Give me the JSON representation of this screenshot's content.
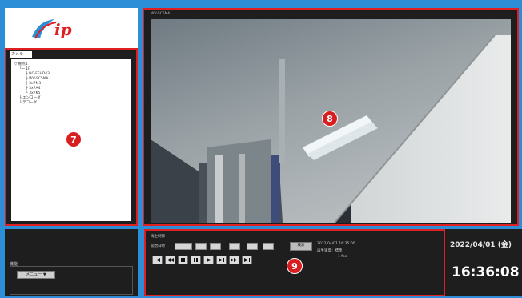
{
  "app": {
    "logo_text": "ip"
  },
  "tree": {
    "tab_label": "カメラ",
    "lines": [
      "▽ 拠点1",
      "└ ─ 1F",
      "├ NC-FFHD43",
      "├ WV-SC5NA",
      "├ 3x7M3",
      "├ 3x7A4",
      "└ 3x7K5",
      "├ エンコーダ",
      "└ デコーダ"
    ]
  },
  "video": {
    "label": "WV-SC5NA"
  },
  "controls": {
    "section_label": "再生制御",
    "start_label": "開始日時",
    "date_fields": [
      "2022",
      "04",
      "01",
      "16",
      "35",
      "00"
    ],
    "search_label": "検索",
    "info_lines": [
      "2022/04/01 16:35:00",
      "再生速度：標準",
      "1 fps"
    ],
    "buttons": [
      "skip-start",
      "rewind",
      "stop",
      "pause",
      "play",
      "step",
      "fast-forward",
      "skip-end"
    ]
  },
  "left_bottom": {
    "label": "機能",
    "button_label": "メニュー ▼"
  },
  "clock": {
    "date": "2022/04/01 (金)",
    "time": "16:36:08"
  },
  "callouts": {
    "tree": "7",
    "video": "8",
    "controls": "9"
  },
  "colors": {
    "frame_blue": "#2b8ed6",
    "highlight_red": "#e02020",
    "callout_red": "#d81e1e",
    "panel_dark": "#1e1e1e"
  }
}
